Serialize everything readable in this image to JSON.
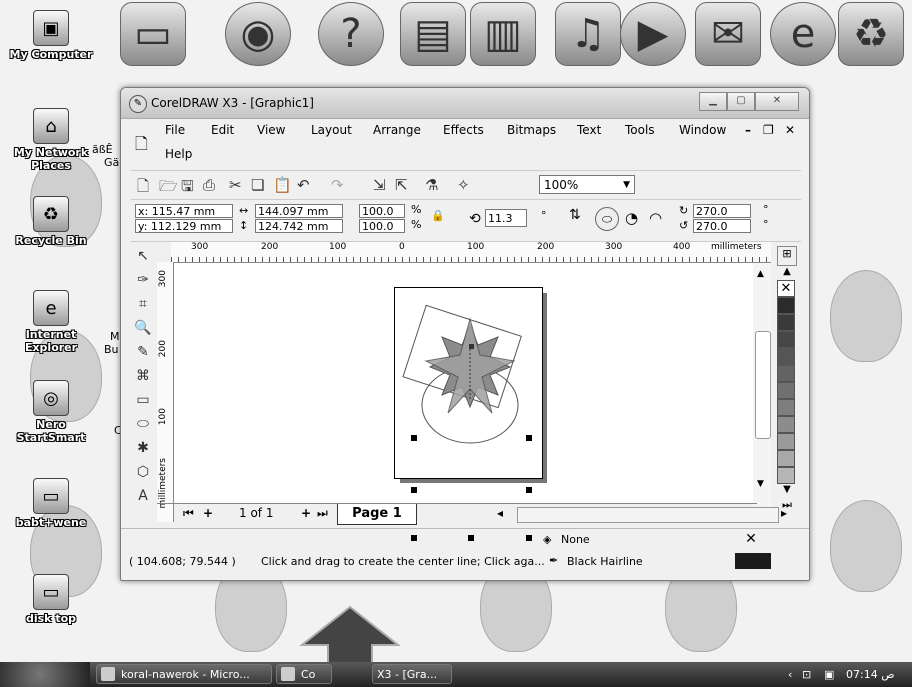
{
  "desktop": {
    "icons": [
      {
        "label": "My Computer",
        "icon": "computer-icon"
      },
      {
        "label": "My Network Places",
        "icon": "network-icon"
      },
      {
        "label": "Recycle Bin",
        "icon": "recycle-bin-icon"
      },
      {
        "label": "Internet Explorer",
        "icon": "ie-icon"
      },
      {
        "label": "Nero StartSmart",
        "icon": "nero-icon"
      },
      {
        "label": "babt+wene",
        "icon": "folder-icon"
      },
      {
        "label": "disk top",
        "icon": "folder-icon"
      }
    ],
    "partial_labels": [
      "ãßÊ",
      "Gä",
      "M",
      "Bu",
      "C"
    ]
  },
  "window": {
    "title": "CorelDRAW X3 - [Graphic1]",
    "menu": [
      "File",
      "Edit",
      "View",
      "Layout",
      "Arrange",
      "Effects",
      "Bitmaps",
      "Text",
      "Tools",
      "Window",
      "Help"
    ],
    "zoom": "100%",
    "props": {
      "x": "x: 115.47 mm",
      "y": "y: 112.129 mm",
      "w": "144.097 mm",
      "h": "124.742 mm",
      "sx": "100.0",
      "sy": "100.0",
      "pct": "%",
      "angle": "11.3",
      "deg": "°",
      "a1": "270.0",
      "a2": "270.0"
    },
    "ruler_units": "millimeters",
    "hruler_ticks": [
      "300",
      "200",
      "100",
      "0",
      "100",
      "200",
      "300",
      "400"
    ],
    "vruler_ticks": [
      "300",
      "200",
      "100"
    ],
    "page_nav": {
      "count": "1 of 1",
      "tab": "Page 1"
    },
    "status": {
      "coords": "( 104.608; 79.544 )",
      "hint": "Click and drag to create the center line; Click aga...",
      "fill": "None",
      "outline": "Black  Hairline"
    }
  },
  "taskbar": {
    "tasks": [
      "koral-nawerok - Micro...",
      "Co",
      "X3 - [Gra..."
    ],
    "time": "07:14 ص"
  }
}
